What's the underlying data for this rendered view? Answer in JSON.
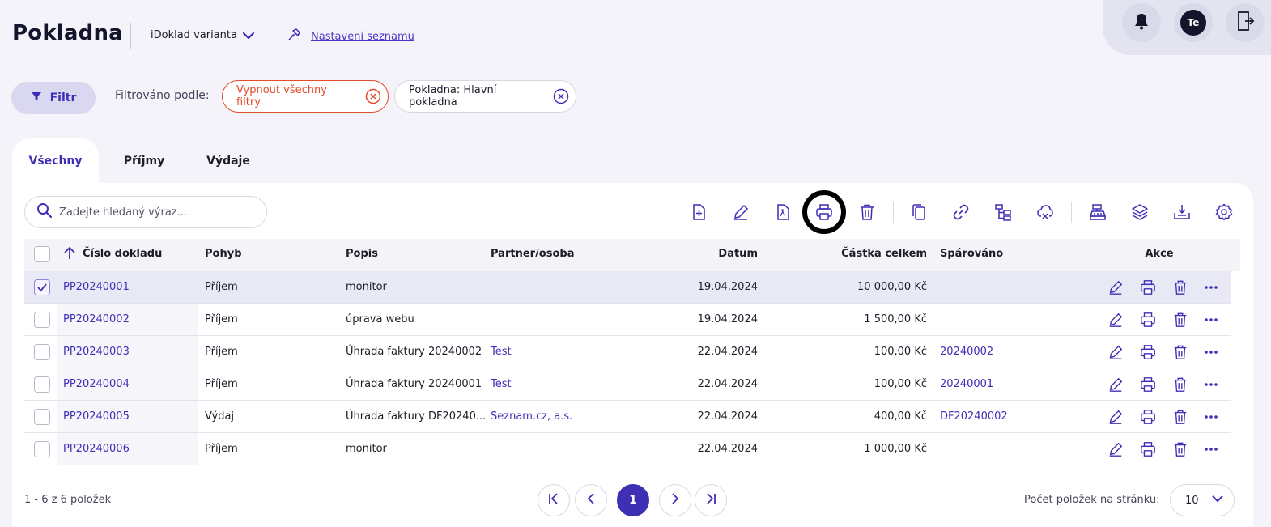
{
  "header": {
    "title": "Pokladna",
    "variant": "iDoklad varianta",
    "settings_link": "Nastavení seznamu",
    "avatar_initials": "Te"
  },
  "filter": {
    "button_label": "Filtr",
    "filtered_by_label": "Filtrováno podle:",
    "clear_all_chip": "Vypnout všechny filtry",
    "active_chip": "Pokladna: Hlavní pokladna"
  },
  "tabs": [
    {
      "label": "Všechny",
      "active": true
    },
    {
      "label": "Příjmy",
      "active": false
    },
    {
      "label": "Výdaje",
      "active": false
    }
  ],
  "search": {
    "placeholder": "Zadejte hledaný výraz..."
  },
  "toolbar": [
    "add-document-icon",
    "edit-icon",
    "pdf-icon",
    "print-icon",
    "delete-icon",
    "copy-icon",
    "link-icon",
    "hierarchy-icon",
    "cloud-icon",
    "cash-register-icon",
    "layers-icon",
    "download-icon",
    "settings-icon"
  ],
  "table": {
    "columns": {
      "number": "Číslo dokladu",
      "movement": "Pohyb",
      "description": "Popis",
      "partner": "Partner/osoba",
      "date": "Datum",
      "total": "Částka celkem",
      "paired": "Spárováno",
      "actions": "Akce"
    },
    "rows": [
      {
        "number": "PP20240001",
        "movement": "Příjem",
        "description": "monitor",
        "partner": "",
        "date": "19.04.2024",
        "total": "10 000,00 Kč",
        "paired": "",
        "selected": true
      },
      {
        "number": "PP20240002",
        "movement": "Příjem",
        "description": "úprava webu",
        "partner": "",
        "date": "19.04.2024",
        "total": "1 500,00 Kč",
        "paired": "",
        "selected": false
      },
      {
        "number": "PP20240003",
        "movement": "Příjem",
        "description": "Úhrada faktury 20240002",
        "partner": "Test",
        "date": "22.04.2024",
        "total": "100,00 Kč",
        "paired": "20240002",
        "selected": false
      },
      {
        "number": "PP20240004",
        "movement": "Příjem",
        "description": "Úhrada faktury 20240001",
        "partner": "Test",
        "date": "22.04.2024",
        "total": "100,00 Kč",
        "paired": "20240001",
        "selected": false
      },
      {
        "number": "PP20240005",
        "movement": "Výdaj",
        "description": "Úhrada faktury DF20240...",
        "partner": "Seznam.cz, a.s.",
        "date": "22.04.2024",
        "total": "400,00 Kč",
        "paired": "DF20240002",
        "selected": false
      },
      {
        "number": "PP20240006",
        "movement": "Příjem",
        "description": "monitor",
        "partner": "",
        "date": "22.04.2024",
        "total": "1 000,00 Kč",
        "paired": "",
        "selected": false
      }
    ]
  },
  "footer": {
    "count": "1 - 6 z 6 položek",
    "current_page": "1",
    "per_page_label": "Počet položek na stránku:",
    "per_page_value": "10"
  },
  "colors": {
    "accent": "#3e2fb5",
    "danger": "#e34b2b",
    "background": "#f3f3f9"
  }
}
